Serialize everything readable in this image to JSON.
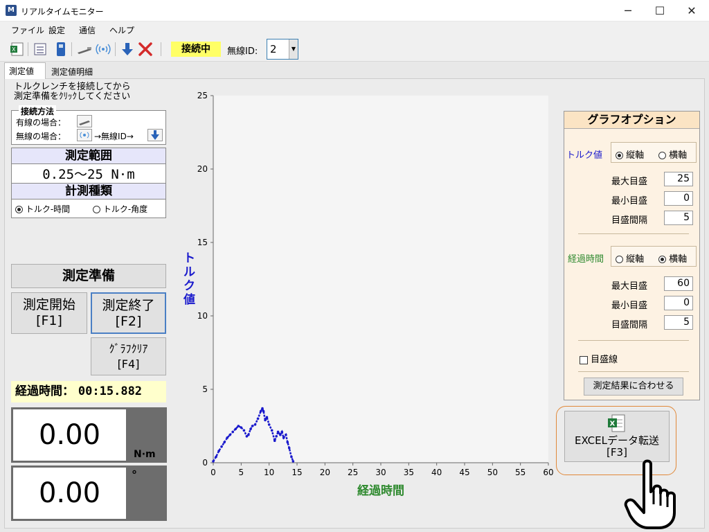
{
  "window": {
    "title": "リアルタイムモニター",
    "app_icon": "app-logo-icon",
    "minimize": "─",
    "maximize": "☐",
    "close": "✕"
  },
  "menu": [
    "ファイル",
    "設定",
    "通信",
    "ヘルプ"
  ],
  "toolbar": {
    "icons": [
      "excel-icon",
      "list-icon",
      "device-icon",
      "wired-wrench-icon",
      "wireless-icon",
      "download-arrow-icon",
      "disconnect-x-icon"
    ],
    "status": "接続中",
    "wireless_id_label": "無線ID:",
    "wireless_id_value": "2"
  },
  "tabs": [
    "測定値",
    "測定値明細"
  ],
  "instructions": {
    "line1": "トルクレンチを接続してから",
    "line2": "測定準備をｸﾘｯｸしてください"
  },
  "connection": {
    "title": "接続方法",
    "wired_label": "有線の場合：",
    "wireless_label": "無線の場合：",
    "wireless_flow": "→無線ID→"
  },
  "range": {
    "head": "測定範囲",
    "value": "0.25～25 N·m",
    "type_head": "計測種類",
    "opt_time": "トルク-時間",
    "opt_angle": "トルク-角度"
  },
  "buttons": {
    "prepare": "測定準備",
    "start": "測定開始",
    "start_key": "[F1]",
    "stop": "測定終了",
    "stop_key": "[F2]",
    "clear": "ｸﾞﾗﾌｸﾘｱ",
    "clear_key": "[F4]"
  },
  "elapsed": {
    "label": "経過時間：",
    "value": "00:15.882"
  },
  "readouts": {
    "torque": "0.00",
    "torque_unit": "N·m",
    "angle": "0.00",
    "angle_unit": "°"
  },
  "chart_data": {
    "type": "line",
    "ylabel": "トルク値",
    "xlabel": "経過時間",
    "xlim": [
      0,
      60
    ],
    "ylim": [
      0,
      25
    ],
    "xticks": [
      "0",
      "5",
      "10",
      "15",
      "20",
      "25",
      "30",
      "35",
      "40",
      "45",
      "50",
      "55",
      "60"
    ],
    "yticks": [
      "0",
      "5",
      "10",
      "15",
      "20",
      "25"
    ],
    "color": "#1a1acc",
    "x": [
      0,
      0.5,
      1,
      1.5,
      2,
      2.5,
      3,
      3.5,
      4,
      4.5,
      5,
      5.5,
      6,
      6.3,
      6.7,
      7,
      7.5,
      8,
      8.5,
      8.8,
      9,
      9.3,
      9.6,
      10,
      10.5,
      11,
      11.3,
      11.6,
      12,
      12.3,
      12.6,
      13,
      13.3,
      13.6,
      14,
      14.3
    ],
    "y": [
      0.1,
      0.4,
      0.8,
      1.1,
      1.4,
      1.7,
      1.9,
      2.1,
      2.3,
      2.5,
      2.4,
      2.2,
      1.8,
      1.9,
      2.3,
      2.5,
      2.6,
      3.0,
      3.5,
      3.7,
      3.5,
      2.9,
      3.1,
      2.6,
      2.2,
      1.5,
      1.8,
      2.1,
      1.9,
      2.1,
      1.7,
      1.9,
      1.4,
      1.0,
      0.4,
      0.1
    ]
  },
  "options": {
    "head": "グラフオプション",
    "torque_label": "トルク値",
    "vertical": "縦軸",
    "horizontal": "横軸",
    "max_label": "最大目盛",
    "min_label": "最小目盛",
    "interval_label": "目盛間隔",
    "torque_max": "25",
    "torque_min": "0",
    "torque_interval": "5",
    "time_label": "経過時間",
    "time_max": "60",
    "time_min": "0",
    "time_interval": "5",
    "gridlines_label": "目盛線",
    "fit_button": "測定結果に合わせる"
  },
  "excel": {
    "label": "EXCELデータ転送",
    "key": "[F3]"
  }
}
